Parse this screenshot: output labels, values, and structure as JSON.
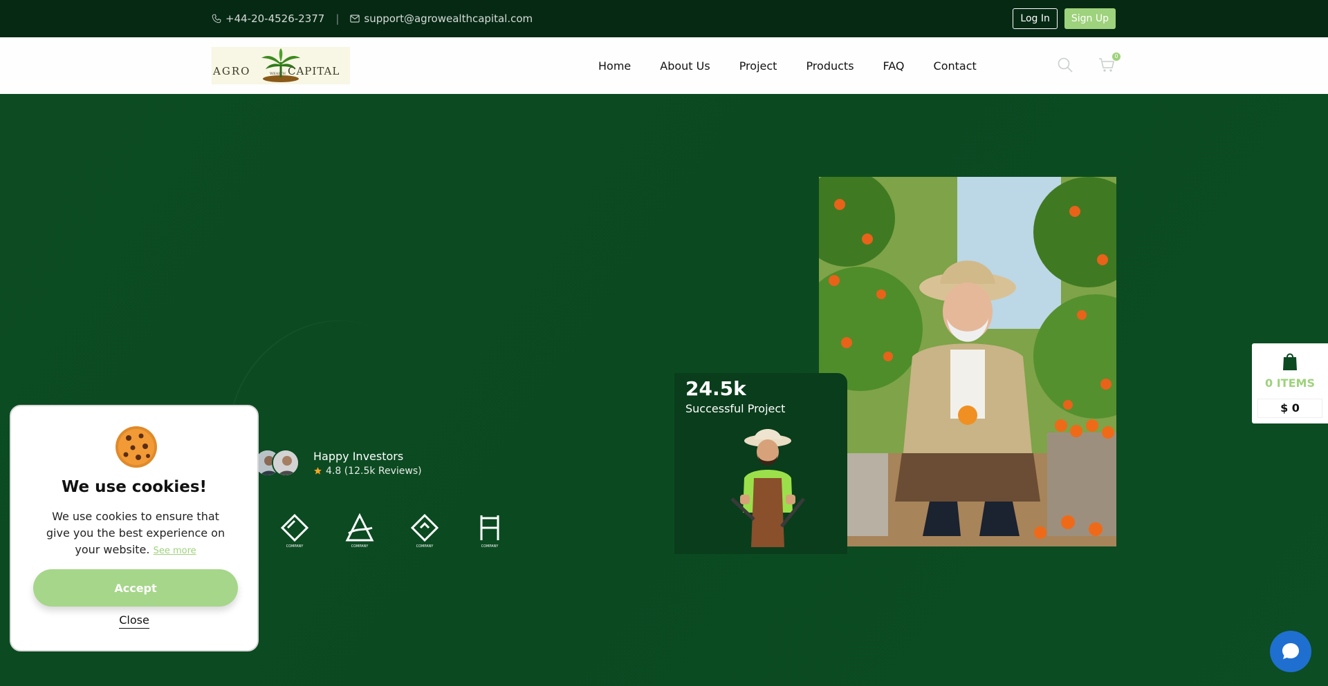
{
  "topbar": {
    "phone": "+44-20-4526-2377",
    "separator": "|",
    "email": "support@agrowealthcapital.com",
    "login_label": "Log In",
    "signup_label": "Sign Up"
  },
  "nav": {
    "logo_text_left": "AGRO",
    "logo_text_mid": "WEALTH",
    "logo_text_right": "CAPITAL",
    "links": [
      "Home",
      "About Us",
      "Project",
      "Products",
      "FAQ",
      "Contact"
    ],
    "cart_count": "0"
  },
  "hero": {
    "stat_value": "24.5k",
    "stat_label": "Successful Project",
    "investors_title": "Happy Investors",
    "investors_rating": "4.8 (12.5k Reviews)",
    "brand_caption": "COMPANY"
  },
  "cookie": {
    "title": "We use cookies!",
    "body": "We use cookies to ensure that give you the best experience on your website.",
    "see_more": "See more",
    "accept_label": "Accept",
    "close_label": "Close"
  },
  "side_cart": {
    "items_label": "0 ITEMS",
    "total": "$ 0"
  },
  "colors": {
    "primary_dark": "#062914",
    "hero_green": "#0c4a22",
    "accent_green": "#9ed27c",
    "chat_blue": "#1f6fd1"
  }
}
